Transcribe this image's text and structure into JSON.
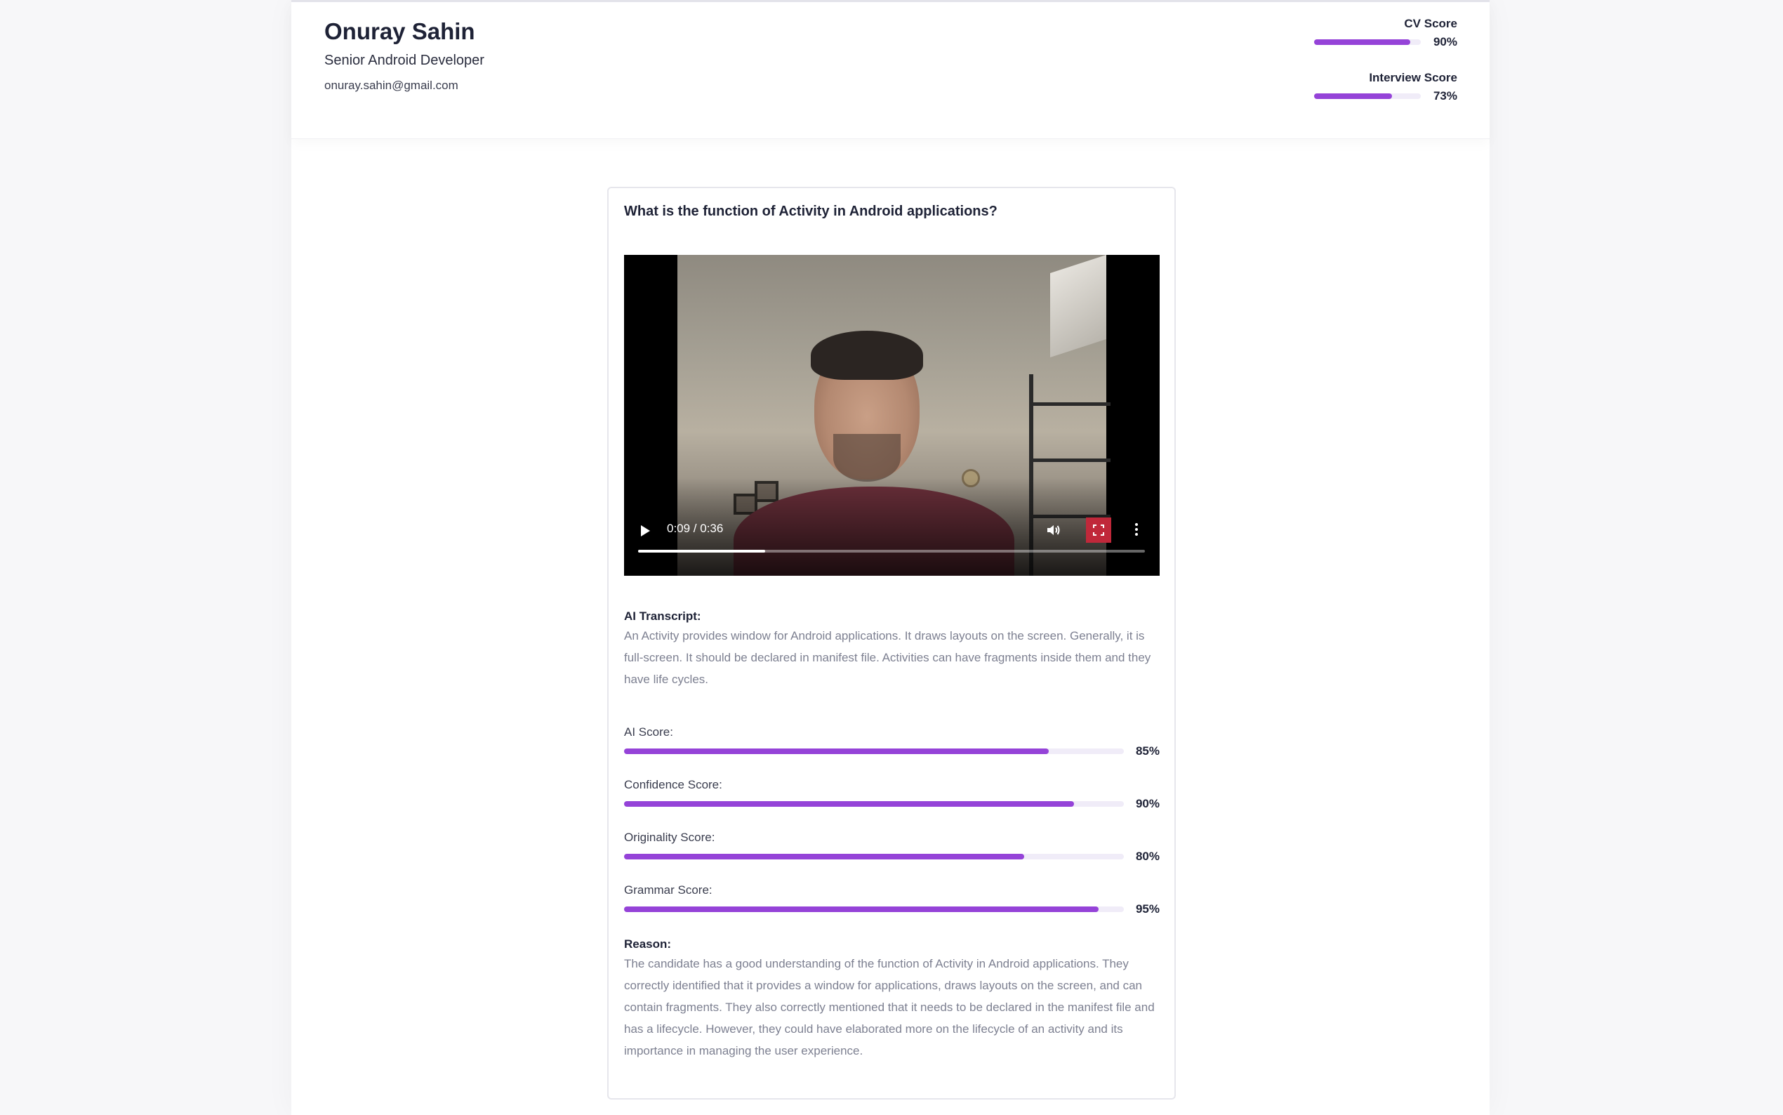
{
  "candidate": {
    "name": "Onuray Sahin",
    "role": "Senior Android Developer",
    "email": "onuray.sahin@gmail.com"
  },
  "header_scores": [
    {
      "label": "CV Score",
      "value": 90,
      "display": "90%"
    },
    {
      "label": "Interview Score",
      "value": 73,
      "display": "73%"
    }
  ],
  "question": {
    "title": "What is the function of Activity in Android applications?",
    "video": {
      "time_display": "0:09 / 0:36",
      "current_seconds": 9,
      "duration_seconds": 36,
      "icons": [
        "play-icon",
        "volume-icon",
        "fullscreen-icon",
        "more-options-icon"
      ]
    },
    "transcript_label": "AI Transcript:",
    "transcript": "An Activity provides window for Android applications. It draws layouts on the screen. Generally, it is full-screen. It should be declared in manifest file. Activities can have fragments inside them and they have life cycles.",
    "scores": [
      {
        "label": "AI Score:",
        "value": 85,
        "display": "85%"
      },
      {
        "label": "Confidence Score:",
        "value": 90,
        "display": "90%"
      },
      {
        "label": "Originality Score:",
        "value": 80,
        "display": "80%"
      },
      {
        "label": "Grammar Score:",
        "value": 95,
        "display": "95%"
      }
    ],
    "reason_label": "Reason:",
    "reason": "The candidate has a good understanding of the function of Activity in Android applications. They correctly identified that it provides a window for applications, draws layouts on the screen, and can contain fragments. They also correctly mentioned that it needs to be declared in the manifest file and has a lifecycle. However, they could have elaborated more on the lifecycle of an activity and its importance in managing the user experience."
  },
  "colors": {
    "accent": "#9543d8",
    "track": "#f0ecf8",
    "text_dark": "#1e2236",
    "text_muted": "#7d8091"
  }
}
